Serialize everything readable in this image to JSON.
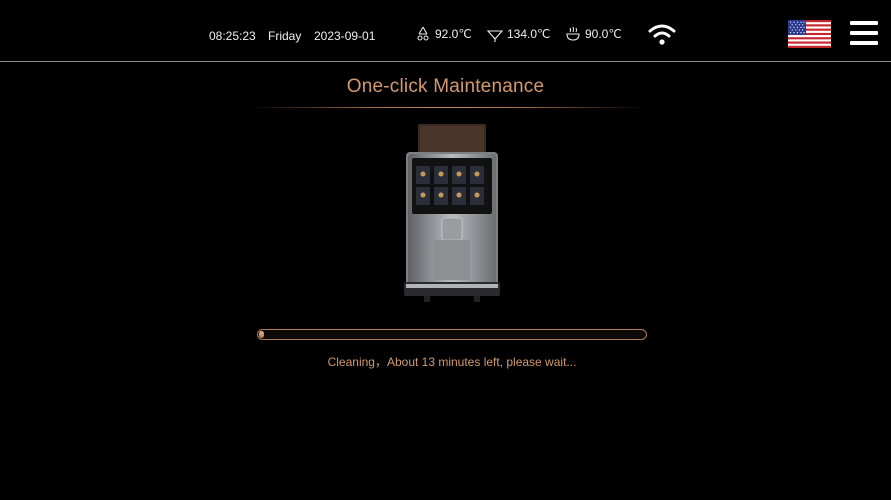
{
  "status_bar": {
    "time": "08:25:23",
    "day": "Friday",
    "date": "2023-09-01",
    "temps": [
      {
        "icon": "water-drop-temp-icon",
        "value": "92.0℃"
      },
      {
        "icon": "steam-temp-icon",
        "value": "134.0℃"
      },
      {
        "icon": "cup-temp-icon",
        "value": "90.0℃"
      }
    ],
    "wifi_icon": "wifi-icon",
    "language_icon": "us-flag-icon",
    "menu_icon": "hamburger-menu-icon"
  },
  "page": {
    "title": "One-click Maintenance",
    "image": "coffee-machine-image"
  },
  "progress": {
    "fraction": 0.012,
    "message": "Cleaning，About 13 minutes left, please wait..."
  },
  "colors": {
    "background": "#000000",
    "accent": "#d39a6e",
    "divider": "#8a8a8a"
  }
}
